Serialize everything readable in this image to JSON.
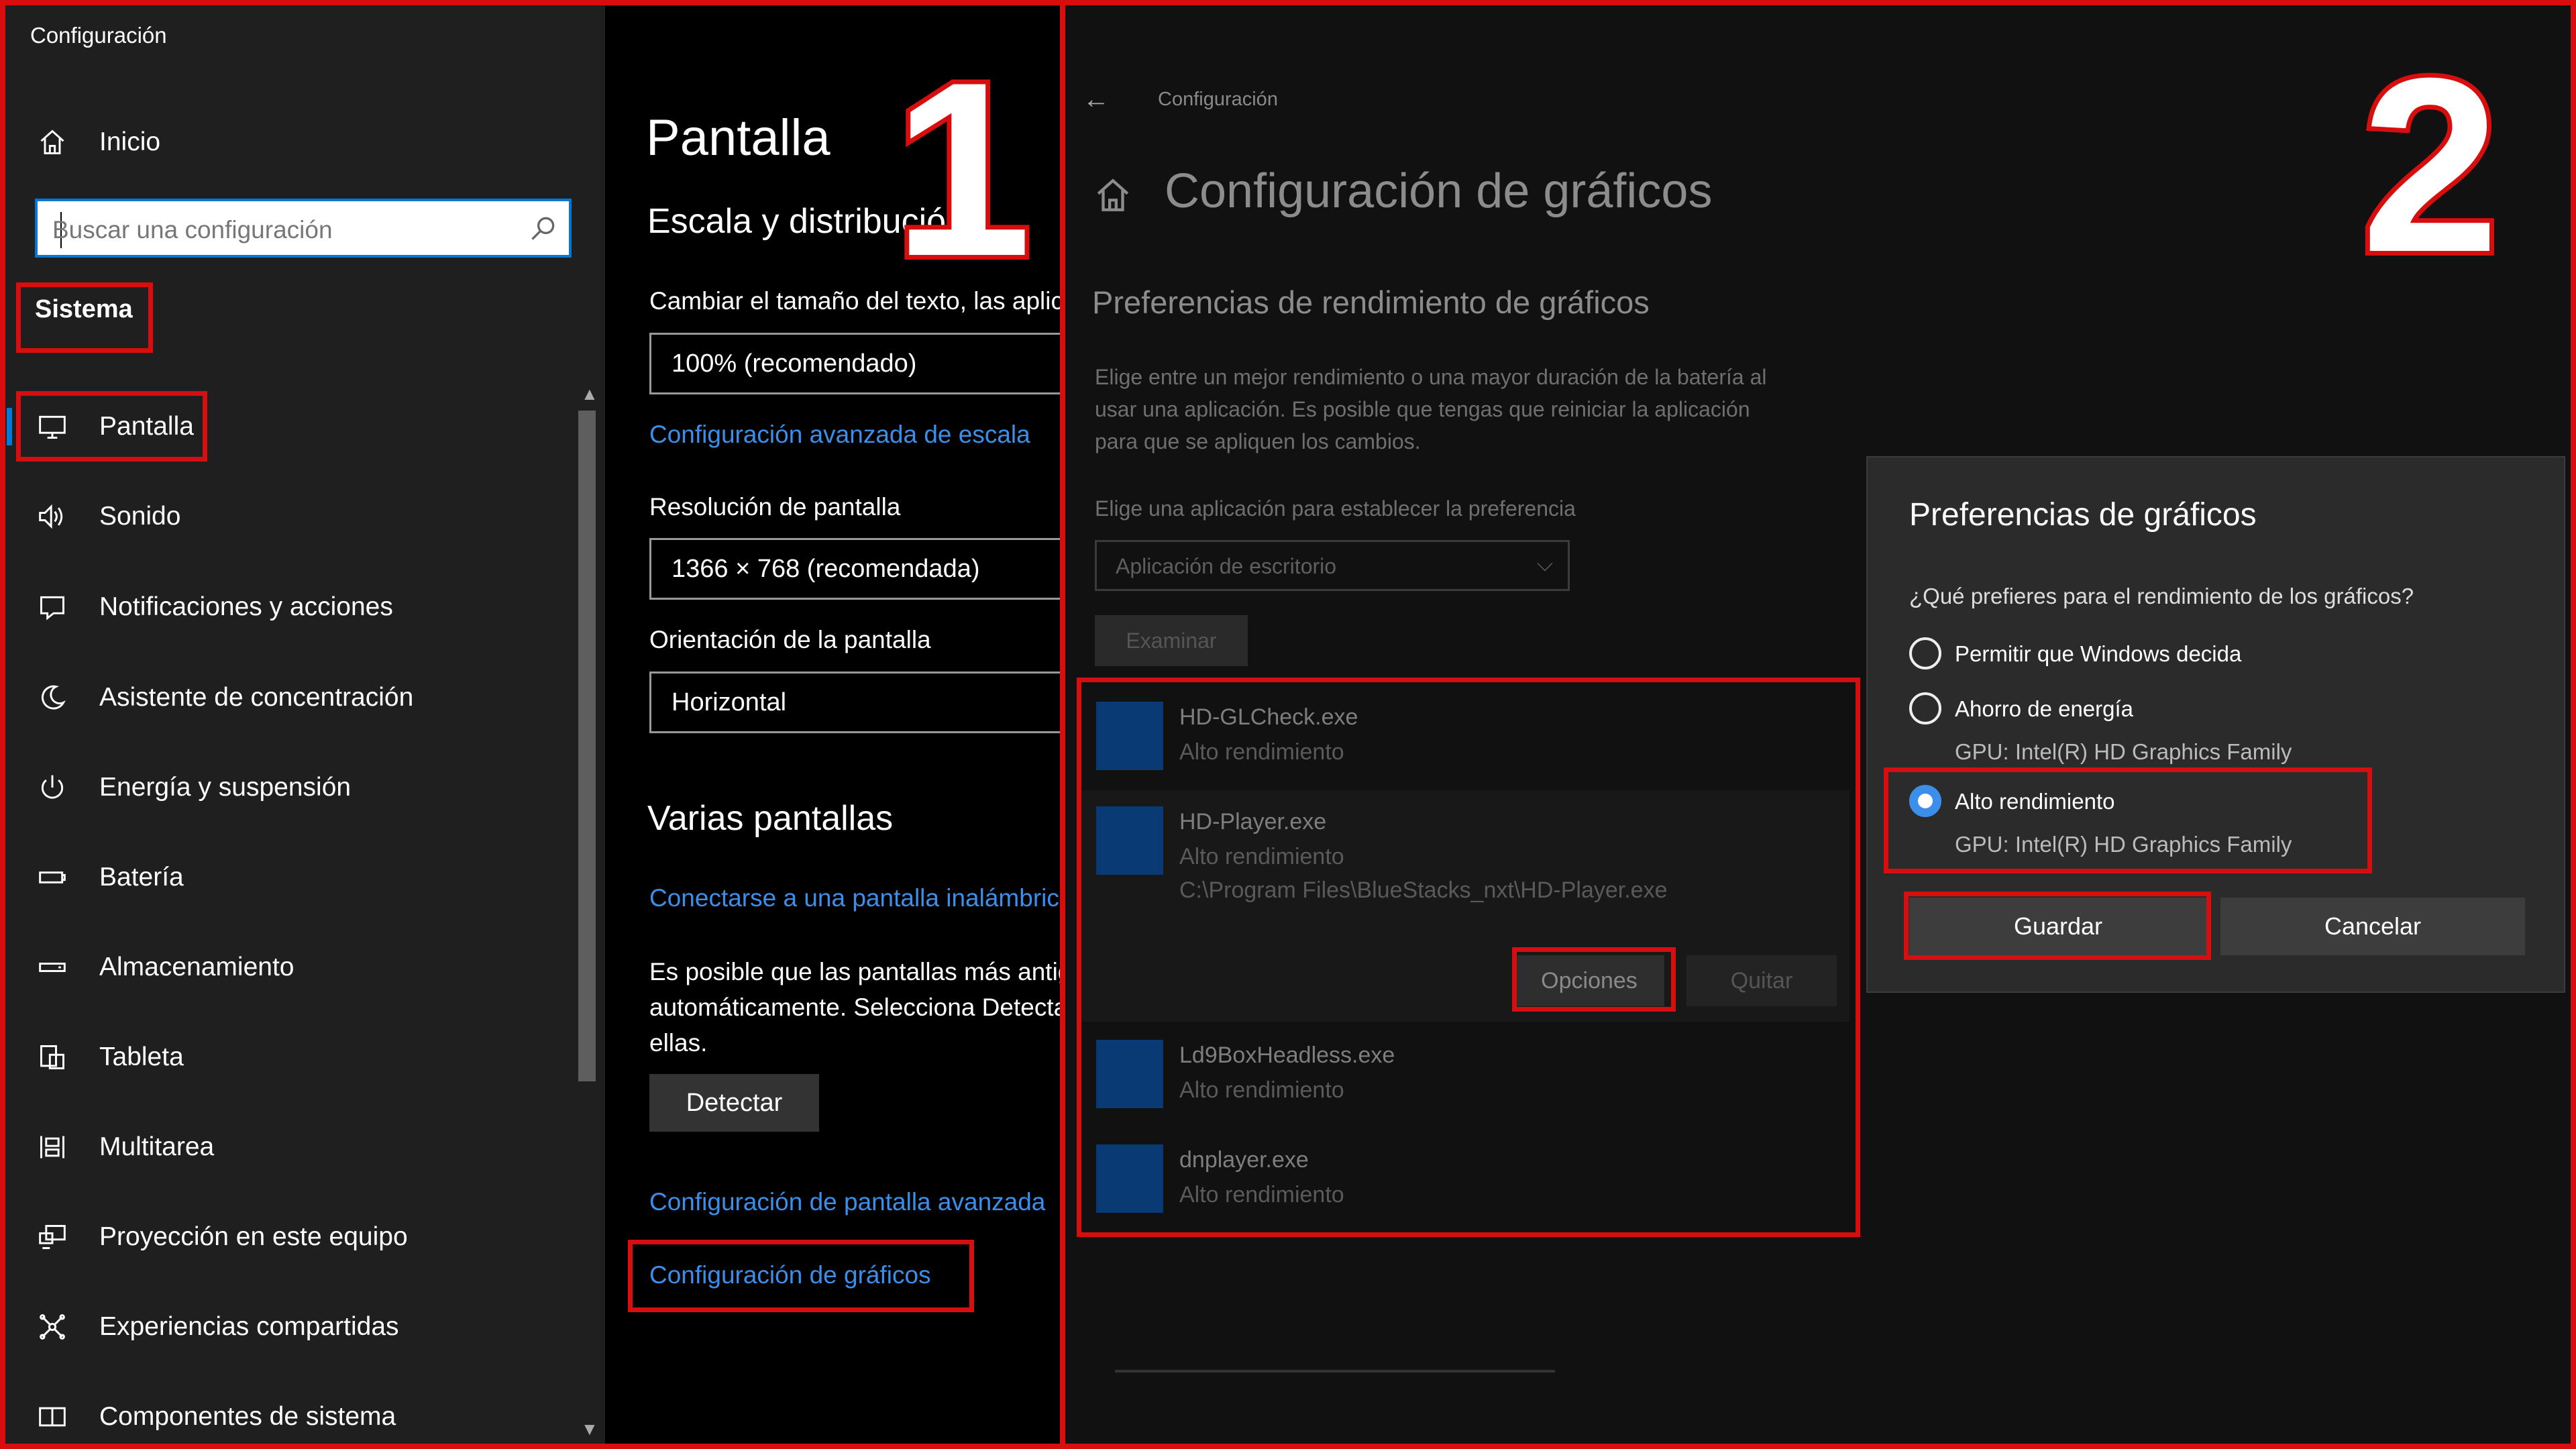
{
  "left": {
    "window_title": "Configuración",
    "home_label": "Inicio",
    "search_placeholder": "Buscar una configuración",
    "section_label": "Sistema",
    "items": [
      {
        "label": "Pantalla",
        "icon": "monitor-icon"
      },
      {
        "label": "Sonido",
        "icon": "speaker-icon"
      },
      {
        "label": "Notificaciones y acciones",
        "icon": "notification-icon"
      },
      {
        "label": "Asistente de concentración",
        "icon": "moon-icon"
      },
      {
        "label": "Energía y suspensión",
        "icon": "power-icon"
      },
      {
        "label": "Batería",
        "icon": "battery-icon"
      },
      {
        "label": "Almacenamiento",
        "icon": "storage-icon"
      },
      {
        "label": "Tableta",
        "icon": "tablet-icon"
      },
      {
        "label": "Multitarea",
        "icon": "multitask-icon"
      },
      {
        "label": "Proyección en este equipo",
        "icon": "projection-icon"
      },
      {
        "label": "Experiencias compartidas",
        "icon": "shared-icon"
      },
      {
        "label": "Componentes de sistema",
        "icon": "components-icon"
      }
    ],
    "content": {
      "title": "Pantalla",
      "scale_heading": "Escala y distribución",
      "text_size_label": "Cambiar el tamaño del texto, las aplicaciones y otros elementos",
      "scale_value": "100% (recomendado)",
      "advanced_scale_link": "Configuración avanzada de escala",
      "resolution_label": "Resolución de pantalla",
      "resolution_value": "1366 × 768 (recomendada)",
      "orientation_label": "Orientación de la pantalla",
      "orientation_value": "Horizontal",
      "multi_heading": "Varias pantallas",
      "wireless_link": "Conectarse a una pantalla inalámbrica",
      "detect_text_1": "Es posible que las pantallas más antiguas no se conecten",
      "detect_text_2": "automáticamente. Selecciona Detectar para intentar conectarte a",
      "detect_text_3": "ellas.",
      "detect_button": "Detectar",
      "advanced_display_link": "Configuración de pantalla avanzada",
      "graphics_link": "Configuración de gráficos"
    },
    "step_number": "1"
  },
  "right": {
    "breadcrumb": "Configuración",
    "title": "Configuración de gráficos",
    "perf_heading": "Preferencias de rendimiento de gráficos",
    "desc_1": "Elige entre un mejor rendimiento o una mayor duración de la batería al",
    "desc_2": "usar una aplicación. Es posible que tengas que reiniciar la aplicación",
    "desc_3": "para que se apliquen los cambios.",
    "choose_label": "Elige una aplicación para establecer la preferencia",
    "app_type_value": "Aplicación de escritorio",
    "browse_button": "Examinar",
    "apps": [
      {
        "name": "HD-GLCheck.exe",
        "perf": "Alto rendimiento"
      },
      {
        "name": "HD-Player.exe",
        "perf": "Alto rendimiento",
        "path": "C:\\Program Files\\BlueStacks_nxt\\HD-Player.exe"
      },
      {
        "name": "Ld9BoxHeadless.exe",
        "perf": "Alto rendimiento"
      },
      {
        "name": "dnplayer.exe",
        "perf": "Alto rendimiento"
      }
    ],
    "options_button": "Opciones",
    "remove_button": "Quitar",
    "step_number": "2",
    "dialog": {
      "title": "Preferencias de gráficos",
      "question": "¿Qué prefieres para el rendimiento de los gráficos?",
      "opt_windows": "Permitir que Windows decida",
      "opt_saving": "Ahorro de energía",
      "opt_saving_gpu": "GPU: Intel(R) HD Graphics Family",
      "opt_high": "Alto rendimiento",
      "opt_high_gpu": "GPU: Intel(R) HD Graphics Family",
      "selected": "Alto rendimiento",
      "save_button": "Guardar",
      "cancel_button": "Cancelar"
    }
  },
  "colors": {
    "highlight": "#d80e0e",
    "link": "#3b8eea",
    "accent": "#0078d7"
  }
}
